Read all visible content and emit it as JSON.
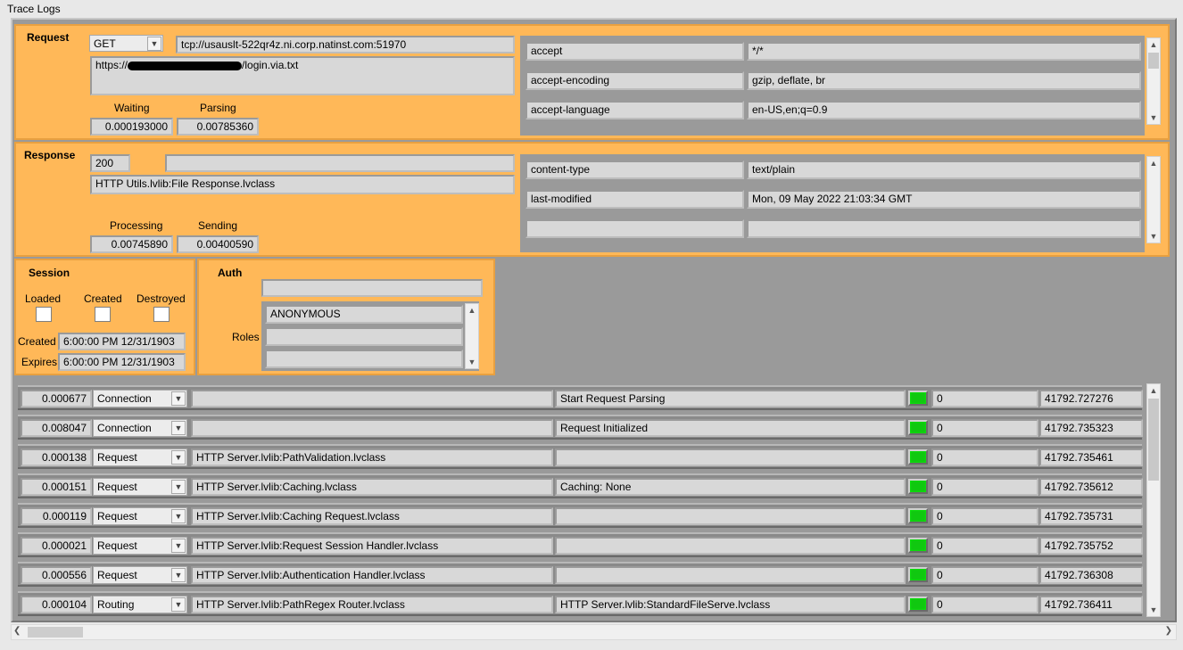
{
  "window": {
    "title": "Trace Logs"
  },
  "request": {
    "label": "Request",
    "method": "GET",
    "connection": "tcp://usauslt-522qr4z.ni.corp.natinst.com:51970",
    "url_prefix": "https://",
    "url_suffix": "/login.via.txt",
    "waiting_label": "Waiting",
    "waiting": "0.000193000",
    "parsing_label": "Parsing",
    "parsing": "0.00785360",
    "headers": [
      {
        "name": "accept",
        "value": "*/*"
      },
      {
        "name": "accept-encoding",
        "value": "gzip, deflate, br"
      },
      {
        "name": "accept-language",
        "value": "en-US,en;q=0.9"
      }
    ]
  },
  "response": {
    "label": "Response",
    "status": "200",
    "status_text": "",
    "handler": "HTTP Utils.lvlib:File Response.lvclass",
    "processing_label": "Processing",
    "processing": "0.00745890",
    "sending_label": "Sending",
    "sending": "0.00400590",
    "headers": [
      {
        "name": "content-type",
        "value": "text/plain"
      },
      {
        "name": "last-modified",
        "value": "Mon, 09 May 2022 21:03:34 GMT"
      },
      {
        "name": "",
        "value": ""
      }
    ]
  },
  "session": {
    "label": "Session",
    "loaded_label": "Loaded",
    "created_label": "Created",
    "destroyed_label": "Destroyed",
    "created_row_label": "Created",
    "created_value": "6:00:00 PM 12/31/1903",
    "expires_label": "Expires",
    "expires_value": "6:00:00 PM 12/31/1903"
  },
  "auth": {
    "label": "Auth",
    "user": "",
    "roles_label": "Roles",
    "roles": [
      "ANONYMOUS",
      "",
      ""
    ]
  },
  "log": [
    {
      "time": "0.000677",
      "type": "Connection",
      "component": "",
      "message": "Start Request Parsing",
      "code": "0",
      "timestamp": "41792.727276"
    },
    {
      "time": "0.008047",
      "type": "Connection",
      "component": "",
      "message": "Request Initialized",
      "code": "0",
      "timestamp": "41792.735323"
    },
    {
      "time": "0.000138",
      "type": "Request",
      "component": "HTTP Server.lvlib:PathValidation.lvclass",
      "message": "",
      "code": "0",
      "timestamp": "41792.735461"
    },
    {
      "time": "0.000151",
      "type": "Request",
      "component": "HTTP Server.lvlib:Caching.lvclass",
      "message": "Caching: None",
      "code": "0",
      "timestamp": "41792.735612"
    },
    {
      "time": "0.000119",
      "type": "Request",
      "component": "HTTP Server.lvlib:Caching Request.lvclass",
      "message": "",
      "code": "0",
      "timestamp": "41792.735731"
    },
    {
      "time": "0.000021",
      "type": "Request",
      "component": "HTTP Server.lvlib:Request Session Handler.lvclass",
      "message": "",
      "code": "0",
      "timestamp": "41792.735752"
    },
    {
      "time": "0.000556",
      "type": "Request",
      "component": "HTTP Server.lvlib:Authentication Handler.lvclass",
      "message": "",
      "code": "0",
      "timestamp": "41792.736308"
    },
    {
      "time": "0.000104",
      "type": "Routing",
      "component": "HTTP Server.lvlib:PathRegex Router.lvclass",
      "message": "HTTP Server.lvlib:StandardFileServe.lvclass",
      "code": "0",
      "timestamp": "41792.736411"
    }
  ],
  "icons": {
    "dropdown": "chevron-down-icon",
    "scroll_up": "chevron-up-icon",
    "scroll_down": "chevron-down-icon",
    "scroll_left": "chevron-left-icon",
    "scroll_right": "chevron-right-icon"
  }
}
